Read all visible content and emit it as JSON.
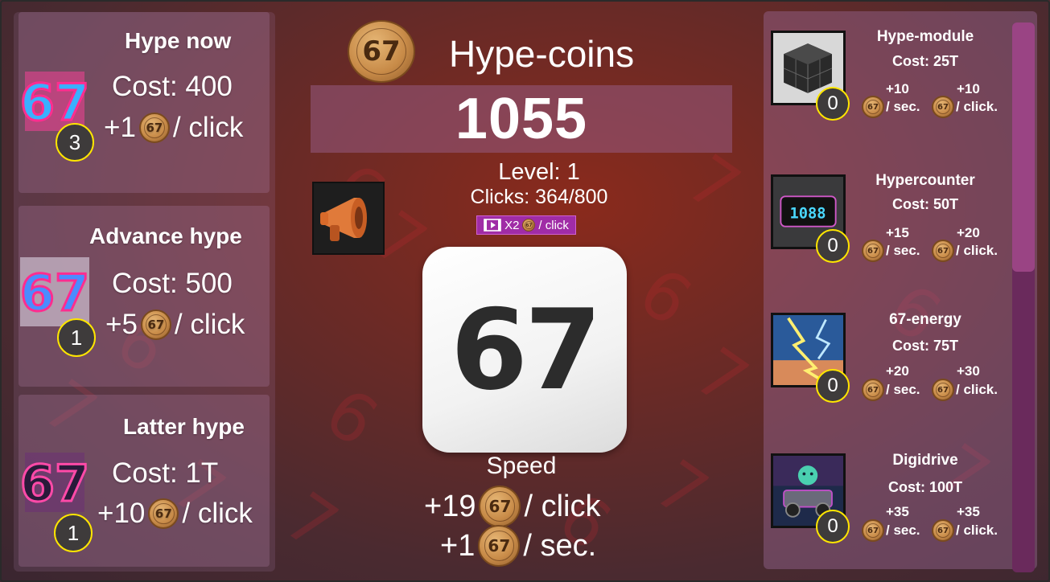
{
  "header": {
    "coin_glyph": "67",
    "title": "Hype-coins"
  },
  "counter": {
    "value": "1055"
  },
  "progress": {
    "level": "Level: 1",
    "clicks": "Clicks: 364/800"
  },
  "ad_boost": {
    "icon": "video-play-icon",
    "label": "X2",
    "unit": "/ click"
  },
  "main_button": {
    "label": "67"
  },
  "speed": {
    "label": "Speed",
    "per_click": "+19",
    "per_click_unit": "/ click",
    "per_sec": "+1",
    "per_sec_unit": "/ sec."
  },
  "click_upgrades": [
    {
      "title": "Hype now",
      "cost": "Cost: 400",
      "gain": "+1",
      "unit": "/ click",
      "count": "3",
      "art_text": "67"
    },
    {
      "title": "Advance hype",
      "cost": "Cost: 500",
      "gain": "+5",
      "unit": "/ click",
      "count": "1",
      "art_text": "67"
    },
    {
      "title": "Latter hype",
      "cost": "Cost: 1T",
      "gain": "+10",
      "unit": "/ click",
      "count": "1",
      "art_text": "67"
    }
  ],
  "generators": [
    {
      "name": "Hype-module",
      "cost": "Cost: 25T",
      "sec_gain": "+10",
      "click_gain": "+10",
      "sec_unit": "/ sec.",
      "click_unit": "/ click.",
      "count": "0",
      "icon": "cube-icon"
    },
    {
      "name": "Hypercounter",
      "cost": "Cost: 50T",
      "sec_gain": "+15",
      "click_gain": "+20",
      "sec_unit": "/ sec.",
      "click_unit": "/ click.",
      "count": "0",
      "icon": "digital-counter-icon",
      "display": "1088"
    },
    {
      "name": "67-energy",
      "cost": "Cost: 75T",
      "sec_gain": "+20",
      "click_gain": "+30",
      "sec_unit": "/ sec.",
      "click_unit": "/ click.",
      "count": "0",
      "icon": "lightning-icon"
    },
    {
      "name": "Digidrive",
      "cost": "Cost: 100T",
      "sec_gain": "+35",
      "click_gain": "+35",
      "sec_unit": "/ sec.",
      "click_unit": "/ click.",
      "count": "0",
      "icon": "robot-car-icon"
    }
  ],
  "scrollbar": {
    "position": 0.0
  },
  "colors": {
    "badge_ring": "#ffe600",
    "ad_button": "#a02ca6",
    "counter_bar": "#965a82",
    "scroll_thumb": "#9a4484"
  }
}
